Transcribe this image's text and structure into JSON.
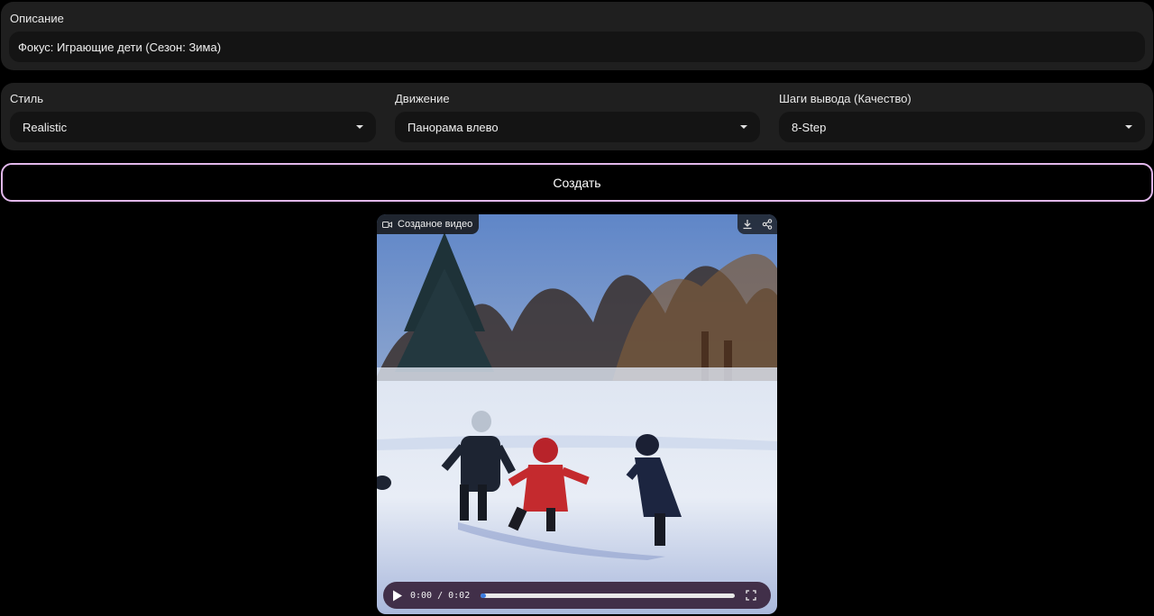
{
  "description": {
    "label": "Описание",
    "value": "Фокус: Играющие дети (Сезон: Зима)"
  },
  "settings": {
    "style": {
      "label": "Стиль",
      "value": "Realistic"
    },
    "motion": {
      "label": "Движение",
      "value": "Панорама влево"
    },
    "steps": {
      "label": "Шаги вывода (Качество)",
      "value": "8-Step"
    }
  },
  "create_button": {
    "label": "Создать"
  },
  "video": {
    "badge_label": "Созданое видео",
    "time": "0:00 / 0:02",
    "progress": 0.02,
    "icons": [
      "video-camera-icon",
      "download-icon",
      "share-icon",
      "play-icon",
      "fullscreen-icon"
    ]
  },
  "colors": {
    "background": "#000000",
    "panel": "#1f1f1f",
    "input": "#141414",
    "button_border": "#e2b8ec",
    "progress_fill": "#3a7be0"
  }
}
